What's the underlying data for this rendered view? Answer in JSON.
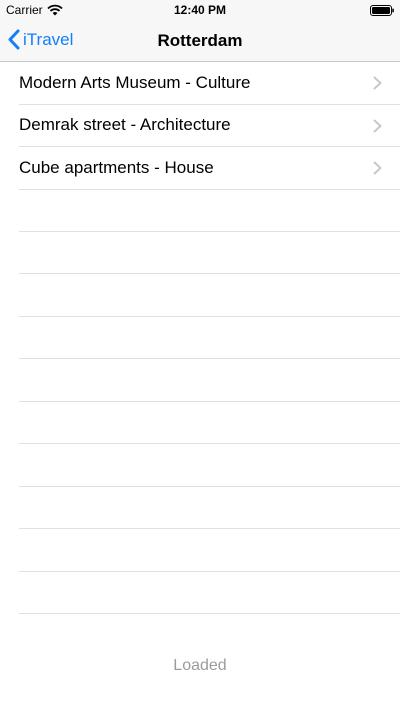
{
  "status_bar": {
    "carrier": "Carrier",
    "time": "12:40 PM"
  },
  "nav": {
    "back_label": "iTravel",
    "title": "Rotterdam"
  },
  "places": [
    {
      "label": "Modern Arts Museum - Culture"
    },
    {
      "label": "Demrak street - Architecture"
    },
    {
      "label": "Cube apartments - House"
    }
  ],
  "footer": {
    "status": "Loaded"
  },
  "colors": {
    "accent": "#147efb",
    "separator": "#e0e0e4",
    "footer_text": "#9b9b9b"
  },
  "icons": {
    "back": "chevron-left-icon",
    "disclosure": "chevron-right-icon",
    "signal": "wifi-icon",
    "battery": "battery-icon"
  }
}
